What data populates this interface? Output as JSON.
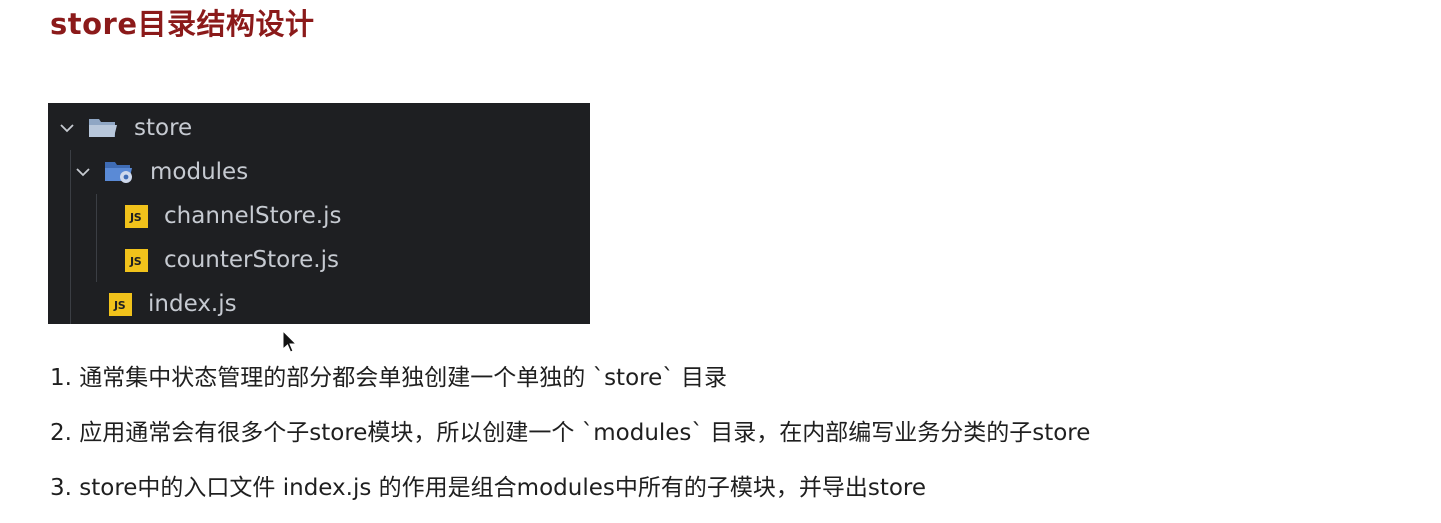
{
  "page": {
    "title": "store目录结构设计"
  },
  "explorer": {
    "items": [
      {
        "label": "store",
        "kind": "folder",
        "expanded": true,
        "icon": "folder-open-icon"
      },
      {
        "label": "modules",
        "kind": "folder",
        "expanded": true,
        "icon": "folder-settings-icon"
      },
      {
        "label": "channelStore.js",
        "kind": "file",
        "icon": "js-file-icon",
        "badge": "JS"
      },
      {
        "label": "counterStore.js",
        "kind": "file",
        "icon": "js-file-icon",
        "badge": "JS"
      },
      {
        "label": "index.js",
        "kind": "file",
        "icon": "js-file-icon",
        "badge": "JS"
      }
    ],
    "colors": {
      "background": "#1e1f22",
      "text": "#c6cad1",
      "folder": "#5a7fb8",
      "js_badge": "#f1c21b"
    }
  },
  "notes": {
    "items": [
      "1. 通常集中状态管理的部分都会单独创建一个单独的 `store` 目录",
      "2. 应用通常会有很多个子store模块，所以创建一个 `modules` 目录，在内部编写业务分类的子store",
      "3. store中的入口文件 index.js 的作用是组合modules中所有的子模块，并导出store"
    ]
  },
  "colors": {
    "title": "#8b1a1a",
    "body_text": "#1f1f1f"
  }
}
